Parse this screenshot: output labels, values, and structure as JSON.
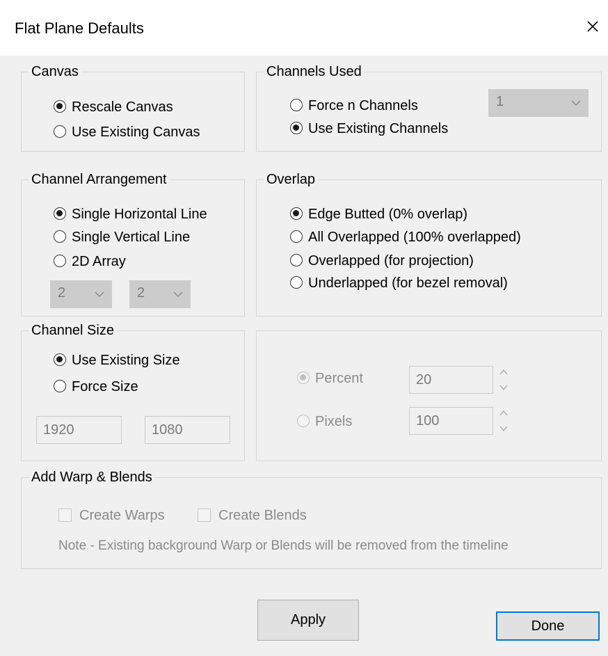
{
  "window": {
    "title": "Flat Plane Defaults",
    "close_icon": "close-icon"
  },
  "canvas": {
    "legend": "Canvas",
    "options": [
      {
        "label": "Rescale Canvas",
        "checked": true
      },
      {
        "label": "Use Existing Canvas",
        "checked": false
      }
    ]
  },
  "channels_used": {
    "legend": "Channels Used",
    "options": [
      {
        "label": "Force n Channels",
        "checked": false
      },
      {
        "label": "Use Existing Channels",
        "checked": true
      }
    ],
    "count_select": {
      "value": "1",
      "enabled": false
    }
  },
  "channel_arrangement": {
    "legend": "Channel Arrangement",
    "options": [
      {
        "label": "Single Horizontal Line",
        "checked": true
      },
      {
        "label": "Single Vertical Line",
        "checked": false
      },
      {
        "label": "2D Array",
        "checked": false
      }
    ],
    "rows_select": {
      "value": "2",
      "enabled": false
    },
    "cols_select": {
      "value": "2",
      "enabled": false
    }
  },
  "overlap": {
    "legend": "Overlap",
    "options": [
      {
        "label": "Edge Butted (0% overlap)",
        "checked": true
      },
      {
        "label": "All Overlapped (100% overlapped)",
        "checked": false
      },
      {
        "label": "Overlapped (for projection)",
        "checked": false
      },
      {
        "label": "Underlapped (for bezel removal)",
        "checked": false
      }
    ]
  },
  "channel_size": {
    "legend": "Channel Size",
    "options": [
      {
        "label": "Use Existing Size",
        "checked": true
      },
      {
        "label": "Force Size",
        "checked": false
      }
    ],
    "width": "1920",
    "height": "1080"
  },
  "overlap_amount": {
    "options": [
      {
        "label": "Percent",
        "checked": true,
        "value": "20"
      },
      {
        "label": "Pixels",
        "checked": false,
        "value": "100"
      }
    ],
    "enabled": false
  },
  "warp_blends": {
    "legend": "Add Warp & Blends",
    "create_warps": "Create Warps",
    "create_blends": "Create Blends",
    "note": "Note - Existing background Warp or Blends will be removed from the timeline"
  },
  "buttons": {
    "apply": "Apply",
    "done": "Done"
  },
  "colors": {
    "accent": "#0078d7",
    "window_bg": "#f0f0f0",
    "disabled_text": "#8a8a8a"
  }
}
